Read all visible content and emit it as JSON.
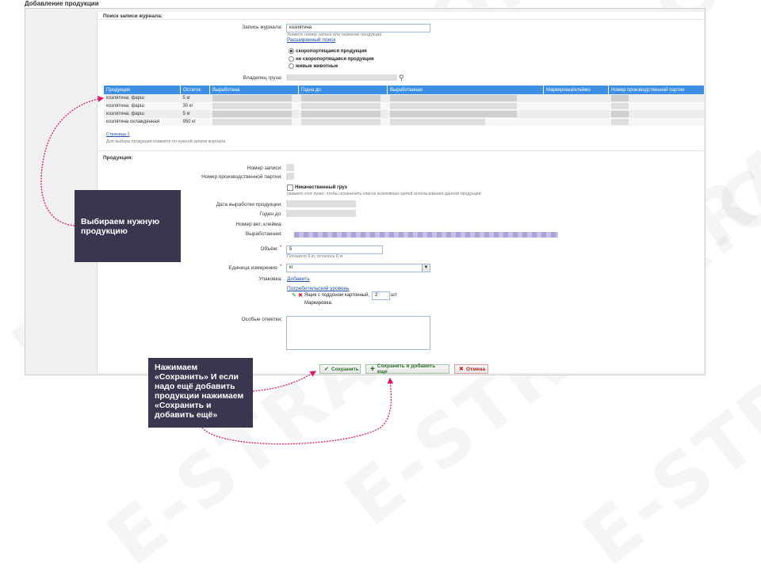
{
  "page_title": "Добавление продукции",
  "colors": {
    "header_blue": "#3c8fe4",
    "callout_bg": "#3a3650",
    "arrow_pink": "#e0186c",
    "link_blue": "#1f4fa8"
  },
  "watermark": [
    "E-STRANA.COM",
    "E-STRANA.COM",
    "E-STRANA.COM",
    "E-STRANA.COM",
    "E-STRANA.COM",
    "E-STRANA.COM"
  ],
  "search": {
    "section_title": "Поиск записи журнала:",
    "journal_label": "Запись журнала:",
    "journal_value": "козлятина",
    "journal_hint": "Укажите номер записи или название продукции",
    "advanced_link": "Расширенный поиск",
    "radios": [
      "скоропортящаяся продукция",
      "не скоропортящаяся продукция",
      "живые животные"
    ],
    "owner_label": "Владелец груза:",
    "search_icon": "magnifier-icon"
  },
  "table": {
    "columns": [
      "Продукция",
      "Остаток",
      "Выработана",
      "Годна до",
      "Выработанная",
      "Маркировка/клеймо",
      "Номер производственной партии"
    ],
    "rows": [
      {
        "product": "козлятина; фарш",
        "rest": "5 кг"
      },
      {
        "product": "козлятина; фарш",
        "rest": "30 кг"
      },
      {
        "product": "козлятина; фарш",
        "rest": "5 кг"
      },
      {
        "product": "козлятина охлажденная",
        "rest": "950 кг"
      }
    ],
    "pagination": "Страница 1",
    "hint": "Для выбора продукции кликните по нужной записи журнала"
  },
  "product": {
    "section_title": "Продукция:",
    "record_no_label": "Номер записи:",
    "batch_label": "Номер производственной партии:",
    "bad_cargo_label": "Некачественный груз",
    "bad_cargo_hint": "укажите этот пункт, чтобы ограничить список возможных целей использования данной продукции",
    "produced_date_label": "Дата выработки продукции:",
    "expiry_label": "Годен до:",
    "vet_mark_label": "Номер вет. клейма:",
    "produced_label": "Выработанная:",
    "volume_label": "Объём:",
    "volume_value": "5",
    "volume_hint": "Погашено 6 кг, осталось 6 кг",
    "unit_label": "Единица измерения:",
    "unit_value": "кг",
    "packing_label": "Упаковка:",
    "packing_link": "Добавить",
    "consumer_level_link": "Потребительский уровень",
    "box_label": "Ящик с поддоном картонный,",
    "box_count": "2",
    "box_unit": "шт",
    "marking_label": "Маркировка:",
    "notes_label": "Особые отметки:",
    "required_mark": "*"
  },
  "buttons": {
    "save": "Сохранить",
    "save_add": "Сохранить и добавить еще",
    "cancel": "Отмена"
  },
  "callouts": {
    "select_product": "Выбираем нужную продукцию",
    "save_text": "Нажимаем «Сохранить» И если надо ещё добавить продукции нажимаем «Сохранить и добавить ещё»"
  }
}
